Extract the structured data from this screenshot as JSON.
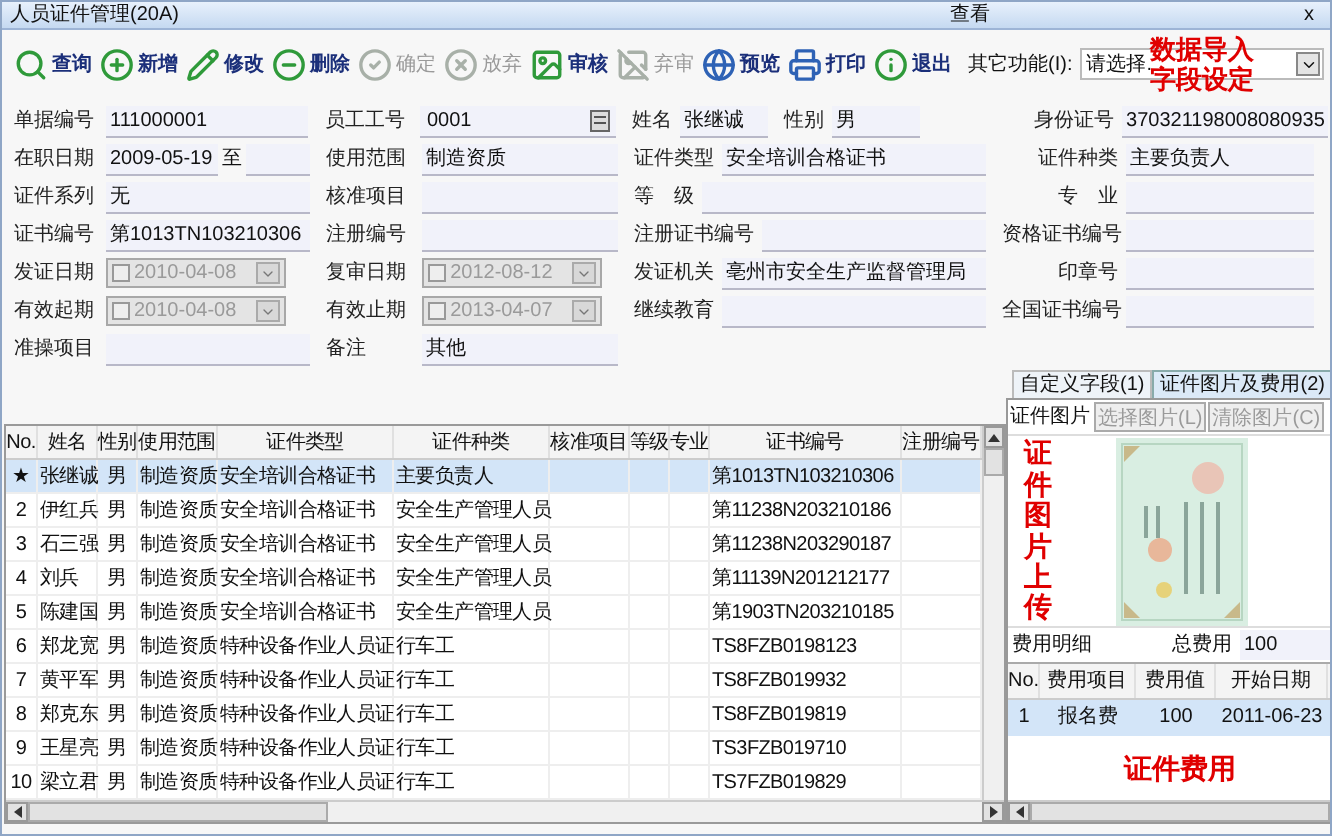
{
  "window": {
    "title": "人员证件管理(20A)",
    "mode": "查看",
    "close": "x"
  },
  "toolbar": {
    "buttons": [
      {
        "label": "查询",
        "disabled": false
      },
      {
        "label": "新增",
        "disabled": false
      },
      {
        "label": "修改",
        "disabled": false
      },
      {
        "label": "删除",
        "disabled": false
      },
      {
        "label": "确定",
        "disabled": true
      },
      {
        "label": "放弃",
        "disabled": true
      },
      {
        "label": "审核",
        "disabled": false
      },
      {
        "label": "弃审",
        "disabled": true
      },
      {
        "label": "预览",
        "disabled": false
      },
      {
        "label": "打印",
        "disabled": false
      },
      {
        "label": "退出",
        "disabled": false
      }
    ],
    "other_label": "其它功能(I):",
    "other_value": "请选择.",
    "note_lines": [
      "数据导入",
      "字段设定"
    ]
  },
  "form": {
    "rows": [
      [
        [
          {
            "label": "单据编号",
            "value": "111000001",
            "kind": "text"
          }
        ],
        [
          {
            "label": "员工工号",
            "value": "0001",
            "kind": "lookup"
          }
        ],
        [
          {
            "label": "姓名",
            "value": "张继诚",
            "kind": "short"
          },
          {
            "label": "性别",
            "value": "男",
            "kind": "short"
          }
        ],
        [
          {
            "label": "身份证号",
            "value": "370321198008080935",
            "kind": "text"
          }
        ]
      ],
      [
        [
          {
            "label": "在职日期",
            "value": "2009-05-19",
            "kind": "range",
            "sep": "至"
          }
        ],
        [
          {
            "label": "使用范围",
            "value": "制造资质",
            "kind": "text"
          }
        ],
        [
          {
            "label": "证件类型",
            "value": "安全培训合格证书",
            "kind": "text"
          }
        ],
        [
          {
            "label": "证件种类",
            "value": "主要负责人",
            "kind": "text"
          }
        ]
      ],
      [
        [
          {
            "label": "证件系列",
            "value": "无",
            "kind": "text"
          }
        ],
        [
          {
            "label": "核准项目",
            "kind": "text"
          }
        ],
        [
          {
            "label": "等　级",
            "kind": "text"
          }
        ],
        [
          {
            "label": "专　业",
            "kind": "text"
          }
        ]
      ],
      [
        [
          {
            "label": "证书编号",
            "value": "第1013TN103210306",
            "kind": "text"
          }
        ],
        [
          {
            "label": "注册编号",
            "kind": "text"
          }
        ],
        [
          {
            "label": "注册证书编号",
            "kind": "text"
          }
        ],
        [
          {
            "label": "资格证书编号",
            "kind": "text"
          }
        ]
      ],
      [
        [
          {
            "label": "发证日期",
            "value": "2010-04-08",
            "kind": "date"
          }
        ],
        [
          {
            "label": "复审日期",
            "value": "2012-08-12",
            "kind": "date"
          }
        ],
        [
          {
            "label": "发证机关",
            "value": "亳州市安全生产监督管理局",
            "kind": "text"
          }
        ],
        [
          {
            "label": "印章号",
            "kind": "text"
          }
        ]
      ],
      [
        [
          {
            "label": "有效起期",
            "value": "2010-04-08",
            "kind": "date"
          }
        ],
        [
          {
            "label": "有效止期",
            "value": "2013-04-07",
            "kind": "date"
          }
        ],
        [
          {
            "label": "继续教育",
            "kind": "text"
          }
        ],
        [
          {
            "label": "全国证书编号",
            "kind": "text"
          }
        ]
      ],
      [
        [
          {
            "label": "准操项目",
            "kind": "text"
          }
        ],
        [
          {
            "label": "备注",
            "value": "其他",
            "kind": "text"
          }
        ],
        [],
        []
      ]
    ]
  },
  "table": {
    "columns": [
      "No.",
      "姓名",
      "性别",
      "使用范围",
      "证件类型",
      "证件种类",
      "核准项目",
      "等级",
      "专业",
      "证书编号",
      "注册编号"
    ],
    "rows": [
      {
        "no": "★",
        "name": "张继诚",
        "gender": "男",
        "scope": "制造资质",
        "type": "安全培训合格证书",
        "category": "主要负责人",
        "cert_no": "第1013TN103210306",
        "selected": true
      },
      {
        "no": "2",
        "name": "伊红兵",
        "gender": "男",
        "scope": "制造资质",
        "type": "安全培训合格证书",
        "category": "安全生产管理人员",
        "cert_no": "第11238N203210186",
        "selected": false
      },
      {
        "no": "3",
        "name": "石三强",
        "gender": "男",
        "scope": "制造资质",
        "type": "安全培训合格证书",
        "category": "安全生产管理人员",
        "cert_no": "第11238N203290187",
        "selected": false
      },
      {
        "no": "4",
        "name": "刘兵",
        "gender": "男",
        "scope": "制造资质",
        "type": "安全培训合格证书",
        "category": "安全生产管理人员",
        "cert_no": "第11139N201212177",
        "selected": false
      },
      {
        "no": "5",
        "name": "陈建国",
        "gender": "男",
        "scope": "制造资质",
        "type": "安全培训合格证书",
        "category": "安全生产管理人员",
        "cert_no": "第1903TN203210185",
        "selected": false
      },
      {
        "no": "6",
        "name": "郑龙宽",
        "gender": "男",
        "scope": "制造资质",
        "type": "特种设备作业人员证",
        "category": "行车工",
        "cert_no": "TS8FZB0198123",
        "selected": false
      },
      {
        "no": "7",
        "name": "黄平军",
        "gender": "男",
        "scope": "制造资质",
        "type": "特种设备作业人员证",
        "category": "行车工",
        "cert_no": "TS8FZB019932",
        "selected": false
      },
      {
        "no": "8",
        "name": "郑克东",
        "gender": "男",
        "scope": "制造资质",
        "type": "特种设备作业人员证",
        "category": "行车工",
        "cert_no": "TS8FZB019819",
        "selected": false
      },
      {
        "no": "9",
        "name": "王星亮",
        "gender": "男",
        "scope": "制造资质",
        "type": "特种设备作业人员证",
        "category": "行车工",
        "cert_no": "TS3FZB019710",
        "selected": false
      },
      {
        "no": "10",
        "name": "梁立君",
        "gender": "男",
        "scope": "制造资质",
        "type": "特种设备作业人员证",
        "category": "行车工",
        "cert_no": "TS7FZB019829",
        "selected": false
      }
    ]
  },
  "side": {
    "tabs": [
      {
        "label": "自定义字段(1)",
        "selected": false
      },
      {
        "label": "证件图片及费用(2)",
        "selected": true
      }
    ],
    "picture_label": "证件图片",
    "picture_buttons": [
      {
        "label": "选择图片(L)",
        "disabled": true
      },
      {
        "label": "清除图片(C)",
        "disabled": true
      }
    ],
    "picture_note": "证件图片上传",
    "fee_label": "费用明细",
    "total_label": "总费用",
    "total_value": "100",
    "fee_columns": [
      "No.",
      "费用项目",
      "费用值",
      "开始日期"
    ],
    "fee_rows": [
      {
        "no": "1",
        "item": "报名费",
        "value": "100",
        "start": "2011-06-23",
        "selected": true
      }
    ],
    "fee_note": "证件费用"
  }
}
